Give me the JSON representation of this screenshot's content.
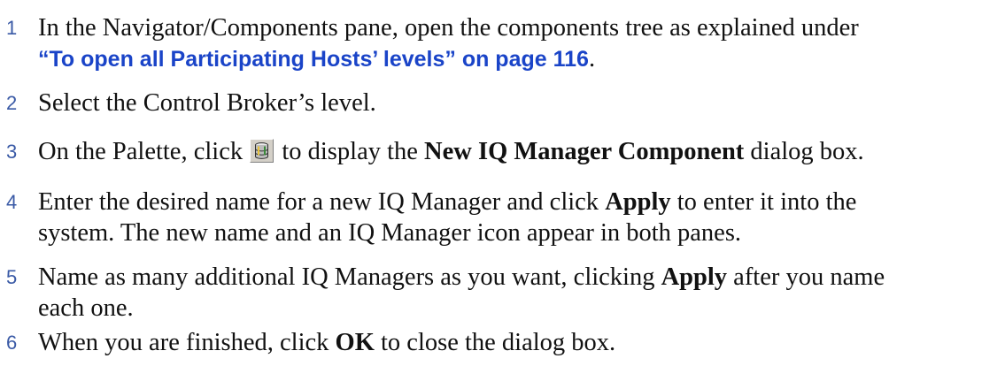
{
  "steps": [
    {
      "number": "1",
      "text_before": "In the Navigator/Components pane, open the components tree as explained under",
      "xref": "“To open all Participating Hosts’ levels” on page 116",
      "text_after": "."
    },
    {
      "number": "2",
      "text": "Select the Control Broker’s level."
    },
    {
      "number": "3",
      "text_before": "On the Palette, click",
      "icon": "iq-manager-palette-icon",
      "text_middle": "to display the",
      "bold": "New IQ Manager Component",
      "text_after": "dialog box."
    },
    {
      "number": "4",
      "text_before": "Enter the desired name for a new IQ Manager and click",
      "bold": "Apply",
      "text_after": "to enter it into the",
      "line2": "system. The new name and an IQ Manager icon appear in both panes."
    },
    {
      "number": "5",
      "text_before": "Name as many additional IQ Managers as you want, clicking",
      "bold": "Apply",
      "text_after": "after you name",
      "line2": "each one."
    },
    {
      "number": "6",
      "text_before": "When you are finished, click",
      "bold": "OK",
      "text_after": "to close the dialog box."
    }
  ]
}
